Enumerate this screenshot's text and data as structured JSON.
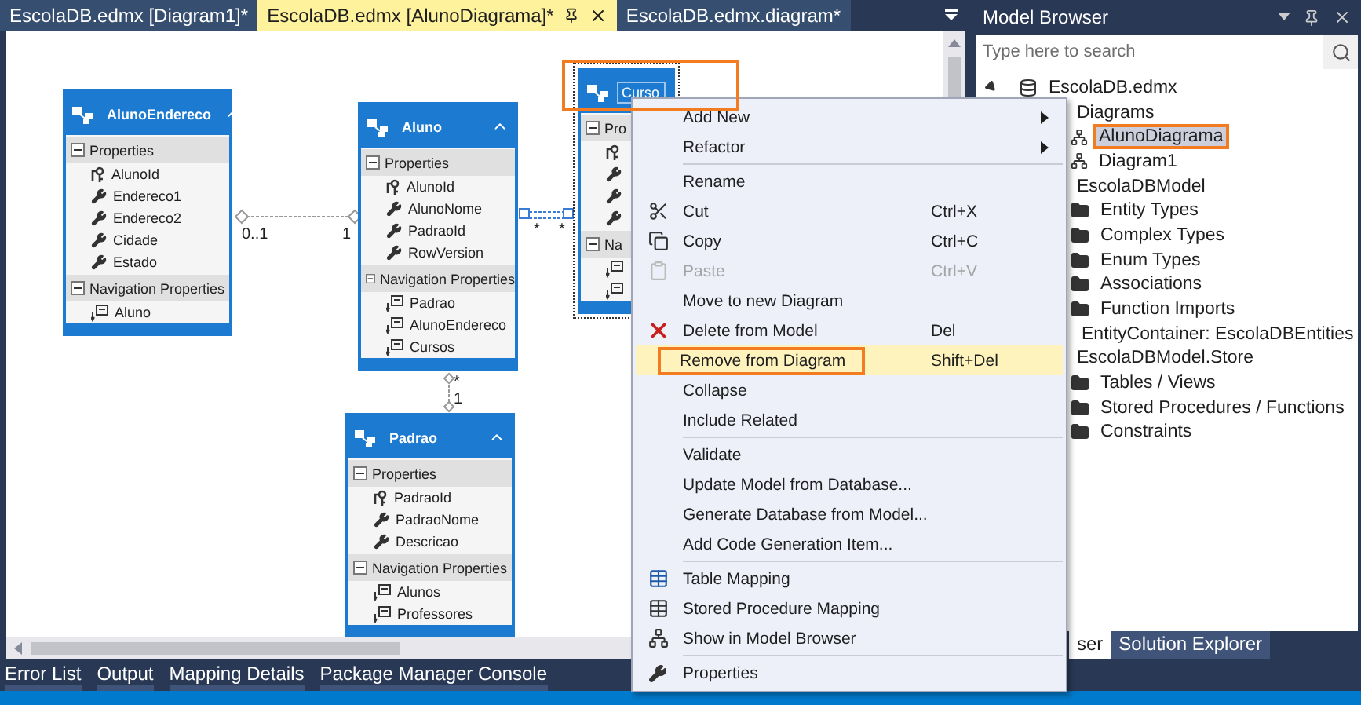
{
  "doc_tabs": [
    {
      "label": "EscolaDB.edmx [Diagram1]*",
      "selected": false
    },
    {
      "label": "EscolaDB.edmx [AlunoDiagrama]*",
      "selected": true
    },
    {
      "label": "EscolaDB.edmx.diagram*",
      "selected": false
    }
  ],
  "entities": [
    {
      "name": "AlunoEndereco",
      "properties": [
        {
          "name": "AlunoId",
          "key": true
        },
        {
          "name": "Endereco1",
          "key": false
        },
        {
          "name": "Endereco2",
          "key": false
        },
        {
          "name": "Cidade",
          "key": false
        },
        {
          "name": "Estado",
          "key": false
        }
      ],
      "nav_header": "Navigation Properties",
      "navigation": [
        {
          "kind": "navigation",
          "name": "Aluno"
        }
      ],
      "props_header": "Properties"
    },
    {
      "name": "Aluno",
      "properties": [
        {
          "name": "AlunoId",
          "key": true
        },
        {
          "name": "AlunoNome",
          "key": false
        },
        {
          "name": "PadraoId",
          "key": false
        },
        {
          "name": "RowVersion",
          "key": false
        }
      ],
      "nav_header": "Navigation Properties",
      "navigation": [
        {
          "kind": "navigation",
          "name": "Padrao"
        },
        {
          "kind": "navigation",
          "name": "AlunoEndereco"
        },
        {
          "kind": "navigation",
          "name": "Cursos"
        }
      ],
      "props_header": "Properties"
    },
    {
      "name": "Padrao",
      "properties": [
        {
          "name": "PadraoId",
          "key": true
        },
        {
          "name": "PadraoNome",
          "key": false
        },
        {
          "name": "Descricao",
          "key": false
        }
      ],
      "nav_header": "Navigation Properties",
      "navigation": [
        {
          "kind": "navigation",
          "name": "Alunos"
        },
        {
          "kind": "navigation",
          "name": "Professores"
        }
      ],
      "props_header": "Properties"
    },
    {
      "name": "Curso",
      "properties": [
        {
          "key": true
        },
        {
          "key": false
        },
        {
          "key": false
        },
        {
          "key": false
        }
      ],
      "nav_header": "Na",
      "navigation": [
        {
          "kind": "navigation"
        },
        {
          "kind": "navigation"
        }
      ],
      "props_header": "Pro",
      "selected": true,
      "callout": true
    }
  ],
  "associations": [
    {
      "from_label": "0..1",
      "to_label": "1"
    },
    {
      "from_label": "*",
      "to_label": "*"
    },
    {
      "from_label": "*",
      "to_label": "1"
    }
  ],
  "context_menu": [
    {
      "kind": "item",
      "label": "Add New",
      "submenu": true
    },
    {
      "kind": "item",
      "label": "Refactor",
      "submenu": true
    },
    {
      "kind": "separator"
    },
    {
      "kind": "item",
      "label": "Rename"
    },
    {
      "kind": "cut",
      "label": "Cut",
      "shortcut": "Ctrl+X"
    },
    {
      "kind": "copy",
      "label": "Copy",
      "shortcut": "Ctrl+C"
    },
    {
      "kind": "paste",
      "label": "Paste",
      "shortcut": "Ctrl+V",
      "disabled": true
    },
    {
      "kind": "item",
      "label": "Move to new Diagram"
    },
    {
      "kind": "delete",
      "label": "Delete from Model",
      "shortcut": "Del"
    },
    {
      "kind": "item",
      "label": "Remove from Diagram",
      "shortcut": "Shift+Del",
      "selected": true,
      "callout": true
    },
    {
      "kind": "item",
      "label": "Collapse"
    },
    {
      "kind": "item",
      "label": "Include Related"
    },
    {
      "kind": "separator"
    },
    {
      "kind": "item",
      "label": "Validate"
    },
    {
      "kind": "item",
      "label": "Update Model from Database..."
    },
    {
      "kind": "item",
      "label": "Generate Database from Model..."
    },
    {
      "kind": "item",
      "label": "Add Code Generation Item..."
    },
    {
      "kind": "separator"
    },
    {
      "kind": "table",
      "label": "Table Mapping"
    },
    {
      "kind": "sproc",
      "label": "Stored Procedure Mapping"
    },
    {
      "kind": "hierarchy",
      "label": "Show in Model Browser"
    },
    {
      "kind": "separator"
    },
    {
      "kind": "wrench",
      "label": "Properties"
    }
  ],
  "model_browser": {
    "title": "Model Browser",
    "search": {
      "placeholder": "Type here to search"
    },
    "tree": [
      {
        "label": "EscolaDB.edmx",
        "kind": "database",
        "expanded": true,
        "children": [
          {
            "label": "Diagrams",
            "children": [
              {
                "label": "AlunoDiagrama",
                "kind": "diagram",
                "selected": true,
                "callout": true
              },
              {
                "label": "Diagram1",
                "kind": "diagram",
                "selected": false
              }
            ]
          },
          {
            "label": "EscolaDBModel",
            "children": [
              {
                "label": "Entity Types",
                "kind": "folder"
              },
              {
                "label": "Complex Types",
                "kind": "folder"
              },
              {
                "label": "Enum Types",
                "kind": "folder"
              },
              {
                "label": "Associations",
                "kind": "folder"
              },
              {
                "label": "Function Imports",
                "kind": "folder"
              },
              {
                "label": "EntityContainer: EscolaDBEntities",
                "kind": "container"
              }
            ]
          },
          {
            "label": "EscolaDBModel.Store",
            "children": [
              {
                "label": "Tables / Views",
                "kind": "folder"
              },
              {
                "label": "Stored Procedures / Functions",
                "kind": "folder"
              },
              {
                "label": "Constraints",
                "kind": "folder"
              }
            ]
          }
        ]
      }
    ],
    "tabs": [
      {
        "label": "ser",
        "selected": true
      },
      {
        "label": "Solution Explorer",
        "selected": false
      }
    ]
  },
  "bottom_tabs": [
    "Error List",
    "Output",
    "Mapping Details",
    "Package Manager Console"
  ]
}
